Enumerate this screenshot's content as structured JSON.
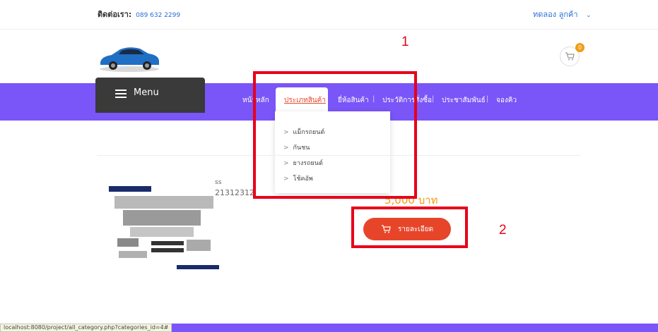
{
  "header": {
    "contact_label": "ติดต่อเรา:",
    "contact_phone": "089 632 2299",
    "account_label": "ทดลอง ลูกค้า"
  },
  "cart": {
    "count": "0"
  },
  "menu": {
    "label": "Menu"
  },
  "nav": {
    "items": [
      "หน้าหลัก",
      "ประเภทสินค้า",
      "ยี่ห้อสินค้า",
      "ประวัติการสั่งซื้อ",
      "ประชาสัมพันธ์",
      "จองคิว"
    ]
  },
  "dropdown": {
    "items": [
      "แม็กรถยนต์",
      "กันชน",
      "ยางรถยนต์",
      "โช้คอัพ"
    ]
  },
  "product": {
    "name": "ss",
    "code": "21312312",
    "price": "5,000 บาท",
    "detail_button": "รายละเอียด"
  },
  "annotations": {
    "label_1": "1",
    "label_2": "2"
  },
  "statusbar": {
    "url": "localhost:8080/project/all_category.php?categories_id=4#"
  },
  "colors": {
    "nav": "#7a55f7",
    "accent": "#e7452a",
    "price": "#f39c12",
    "annotation": "#e8001a"
  }
}
